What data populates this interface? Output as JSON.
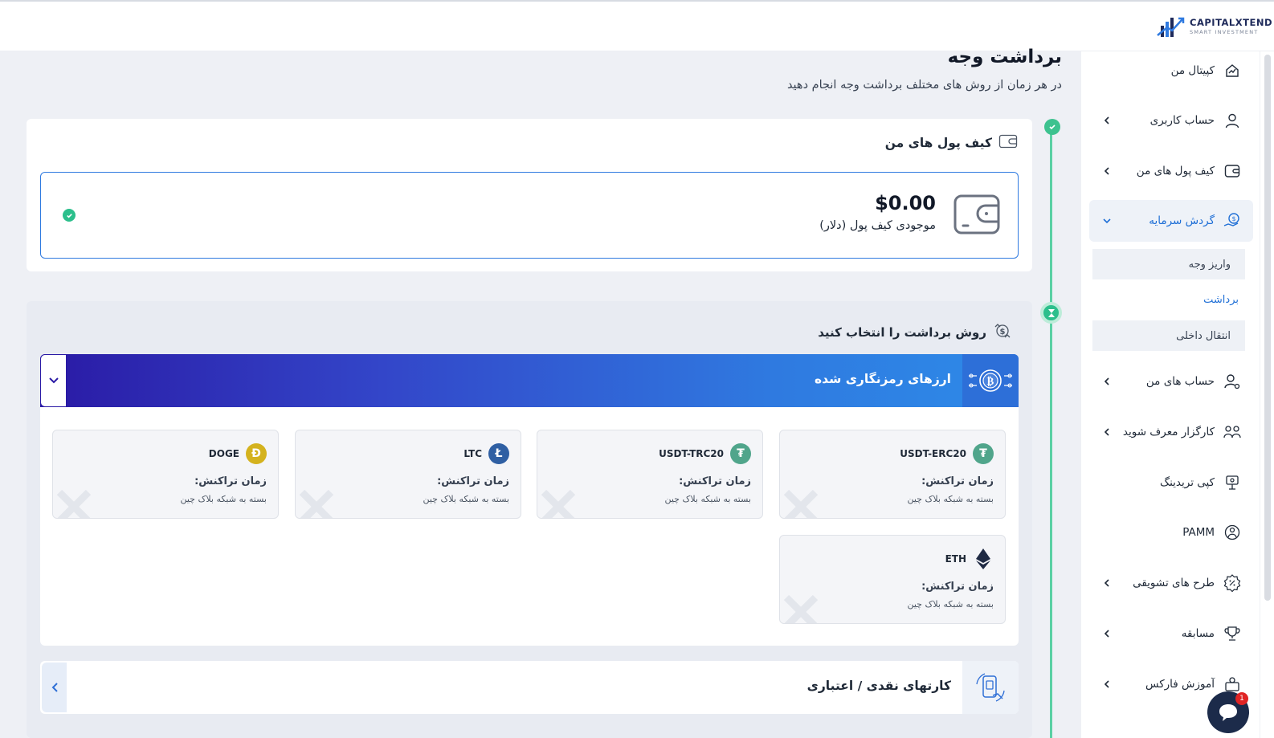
{
  "brand": {
    "name": "CAPITALXTEND",
    "tagline": "SMART INVESTMENT",
    "colors": {
      "accent": "#2f7ae0",
      "success": "#3dc28f",
      "gradient_start": "#2a1aa5",
      "gradient_end": "#2e8ae8"
    }
  },
  "sidebar": {
    "items": [
      {
        "label": "کپیتال من",
        "icon": "chart-icon",
        "chevron": false
      },
      {
        "label": "حساب کاربری",
        "icon": "user-icon",
        "chevron": true
      },
      {
        "label": "کیف پول های من",
        "icon": "wallet-icon",
        "chevron": true
      },
      {
        "label": "گردش سرمایه",
        "icon": "money-hand-icon",
        "chevron": true,
        "active": true
      },
      {
        "label": "حساب های من",
        "icon": "user-settings-icon",
        "chevron": true
      },
      {
        "label": "کارگزار معرف شوید",
        "icon": "group-icon",
        "chevron": true
      },
      {
        "label": "کپی تریدینگ",
        "icon": "copy-trading-icon",
        "chevron": false
      },
      {
        "label": "PAMM",
        "icon": "pamm-icon",
        "chevron": false
      },
      {
        "label": "طرح های تشویقی",
        "icon": "discount-badge-icon",
        "chevron": true
      },
      {
        "label": "مسابقه",
        "icon": "trophy-icon",
        "chevron": true
      },
      {
        "label": "آموزش فارکس",
        "icon": "education-icon",
        "chevron": true
      }
    ],
    "subitems": [
      {
        "label": "واریز وجه"
      },
      {
        "label": "برداشت",
        "current": true
      },
      {
        "label": "انتقال داخلی"
      }
    ]
  },
  "page": {
    "title": "برداشت وجه",
    "subtitle": "در هر زمان از روش های مختلف برداشت وجه انجام دهید"
  },
  "wallets": {
    "heading": "کیف پول های من",
    "balance_amount": "$0.00",
    "balance_label": "موجودی کیف پول (دلار)"
  },
  "methods": {
    "heading": "روش برداشت را انتخاب کنید",
    "crypto": {
      "title": "ارزهای رمزنگاری شده",
      "coins": [
        {
          "symbol": "USDT-ERC20",
          "color": "#50a58b",
          "glyph": "₮",
          "time_label": "زمان تراکنش:",
          "network_note": "بسته به شبکه بلاک چین"
        },
        {
          "symbol": "USDT-TRC20",
          "color": "#50a58b",
          "glyph": "₮",
          "time_label": "زمان تراکنش:",
          "network_note": "بسته به شبکه بلاک چین"
        },
        {
          "symbol": "LTC",
          "color": "#2f5fa3",
          "glyph": "Ł",
          "time_label": "زمان تراکنش:",
          "network_note": "بسته به شبکه بلاک چین"
        },
        {
          "symbol": "DOGE",
          "color": "#d4b21e",
          "glyph": "Ð",
          "time_label": "زمان تراکنش:",
          "network_note": "بسته به شبکه بلاک چین"
        },
        {
          "symbol": "ETH",
          "color": "#1f2a44",
          "glyph": "eth",
          "time_label": "زمان تراکنش:",
          "network_note": "بسته به شبکه بلاک چین"
        }
      ]
    },
    "cards": {
      "title": "کارتهای نقدی / اعتباری"
    }
  },
  "chat": {
    "badge": "1"
  }
}
